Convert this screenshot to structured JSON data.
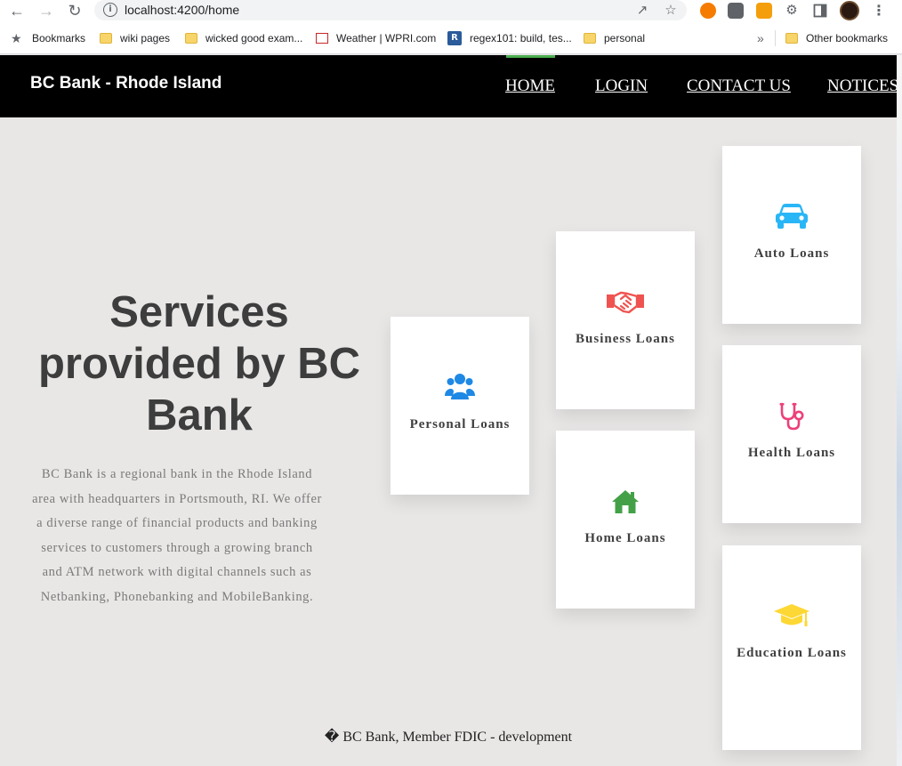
{
  "browser": {
    "url": "localhost:4200/home",
    "bookmarks": [
      {
        "label": "Bookmarks",
        "icon": "star-icon"
      },
      {
        "label": "wiki pages",
        "icon": "folder-icon"
      },
      {
        "label": "wicked good exam...",
        "icon": "folder-icon"
      },
      {
        "label": "Weather | WPRI.com",
        "icon": "wpri-icon"
      },
      {
        "label": "regex101: build, tes...",
        "icon": "regex101-icon"
      },
      {
        "label": "personal",
        "icon": "folder-icon"
      }
    ],
    "overflow_label": "»",
    "other_bookmarks": "Other bookmarks",
    "regex_badge": "R"
  },
  "nav": {
    "brand": "BC Bank - Rhode Island",
    "links": [
      "HOME",
      "LOGIN",
      "CONTACT US",
      "NOTICES"
    ],
    "active": "HOME",
    "accent": "#4caf50"
  },
  "hero": {
    "title": "Services provided by BC Bank",
    "description": "BC Bank is a regional bank in the Rhode Island area with headquarters in Portsmouth, RI. We offer a diverse range of financial products and banking services to customers through a growing branch and ATM network with digital channels such as Netbanking, Phonebanking and MobileBanking."
  },
  "services": [
    {
      "label": "Personal Loans",
      "icon": "users-icon",
      "color": "#1e88e5"
    },
    {
      "label": "Business Loans",
      "icon": "handshake-icon",
      "color": "#ef5350"
    },
    {
      "label": "Home Loans",
      "icon": "home-icon",
      "color": "#43a047"
    },
    {
      "label": "Auto Loans",
      "icon": "car-icon",
      "color": "#29b6f6"
    },
    {
      "label": "Health Loans",
      "icon": "stethoscope-icon",
      "color": "#ec407a"
    },
    {
      "label": "Education Loans",
      "icon": "graduation-cap-icon",
      "color": "#fdd835"
    }
  ],
  "footer": {
    "text": "� BC Bank, Member FDIC - development"
  }
}
